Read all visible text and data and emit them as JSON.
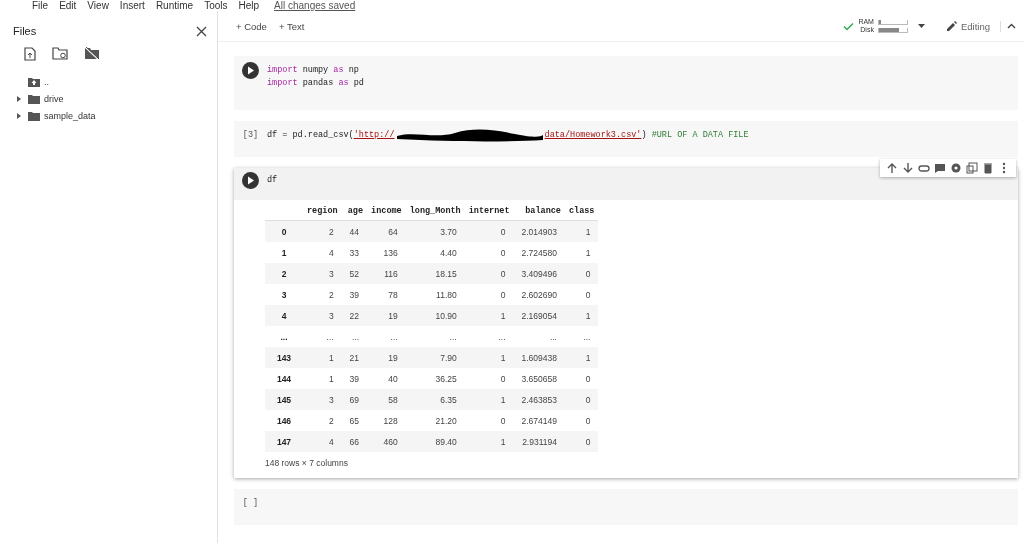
{
  "menu": [
    "File",
    "Edit",
    "View",
    "Insert",
    "Runtime",
    "Tools",
    "Help"
  ],
  "save_status": "All changes saved",
  "sidebar": {
    "title": "Files",
    "items": [
      {
        "label": "..",
        "kind": "parent"
      },
      {
        "label": "drive",
        "kind": "folder"
      },
      {
        "label": "sample_data",
        "kind": "folder"
      }
    ]
  },
  "toolbar": {
    "buttons": [
      "+ Code",
      "+ Text"
    ],
    "ram_label": "RAM",
    "disk_label": "Disk",
    "mode": "Editing"
  },
  "cells": [
    {
      "kind": "code",
      "selected": false,
      "lines": [
        [
          {
            "t": "import",
            "kind": "keyword"
          },
          {
            "t": " numpy ",
            "kind": "plain"
          },
          {
            "t": "as",
            "kind": "keyword"
          },
          {
            "t": " np",
            "kind": "plain"
          }
        ],
        [
          {
            "t": "import",
            "kind": "keyword"
          },
          {
            "t": " pandas ",
            "kind": "plain"
          },
          {
            "t": "as",
            "kind": "keyword"
          },
          {
            "t": " pd",
            "kind": "plain"
          }
        ]
      ]
    },
    {
      "kind": "code",
      "selected": false,
      "prompt": "[3]",
      "lines": [
        [
          {
            "t": "df = pd.read_csv(",
            "kind": "plain"
          },
          {
            "t": "'http://",
            "kind": "string"
          },
          {
            "kind": "redacted"
          },
          {
            "t": "data/Homework3.csv'",
            "kind": "string"
          },
          {
            "t": ") ",
            "kind": "plain"
          },
          {
            "t": "#URL OF A DATA FILE",
            "kind": "comment"
          }
        ]
      ]
    },
    {
      "kind": "code",
      "selected": true,
      "lines": [
        [
          {
            "t": "df",
            "kind": "plain"
          }
        ]
      ],
      "output": {
        "columns": [
          "region",
          "age",
          "income",
          "long_Month",
          "internet",
          "balance",
          "class"
        ],
        "rows": [
          {
            "index": "0",
            "values": [
              "2",
              "44",
              "64",
              "3.70",
              "0",
              "2.014903",
              "1"
            ]
          },
          {
            "index": "1",
            "values": [
              "4",
              "33",
              "136",
              "4.40",
              "0",
              "2.724580",
              "1"
            ]
          },
          {
            "index": "2",
            "values": [
              "3",
              "52",
              "116",
              "18.15",
              "0",
              "3.409496",
              "0"
            ]
          },
          {
            "index": "3",
            "values": [
              "2",
              "39",
              "78",
              "11.80",
              "0",
              "2.602690",
              "0"
            ]
          },
          {
            "index": "4",
            "values": [
              "3",
              "22",
              "19",
              "10.90",
              "1",
              "2.169054",
              "1"
            ]
          },
          {
            "index": "...",
            "values": [
              "...",
              "...",
              "...",
              "...",
              "...",
              "...",
              "..."
            ]
          },
          {
            "index": "143",
            "values": [
              "1",
              "21",
              "19",
              "7.90",
              "1",
              "1.609438",
              "1"
            ]
          },
          {
            "index": "144",
            "values": [
              "1",
              "39",
              "40",
              "36.25",
              "0",
              "3.650658",
              "0"
            ]
          },
          {
            "index": "145",
            "values": [
              "3",
              "69",
              "58",
              "6.35",
              "1",
              "2.463853",
              "0"
            ]
          },
          {
            "index": "146",
            "values": [
              "2",
              "65",
              "128",
              "21.20",
              "0",
              "2.674149",
              "0"
            ]
          },
          {
            "index": "147",
            "values": [
              "4",
              "66",
              "460",
              "89.40",
              "1",
              "2.931194",
              "0"
            ]
          }
        ],
        "summary": "148 rows × 7 columns"
      }
    },
    {
      "kind": "code",
      "selected": false,
      "prompt": "[ ]"
    }
  ]
}
